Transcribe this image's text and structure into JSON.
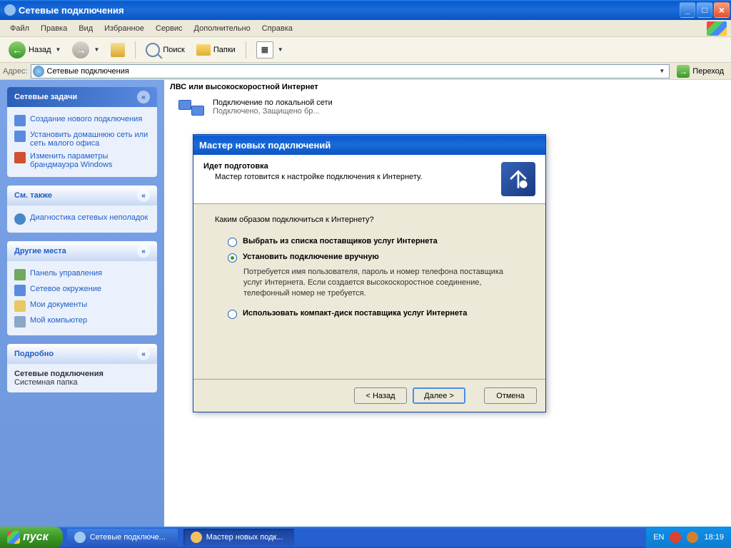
{
  "window": {
    "title": "Сетевые подключения"
  },
  "menu": {
    "file": "Файл",
    "edit": "Правка",
    "view": "Вид",
    "favorites": "Избранное",
    "service": "Сервис",
    "extra": "Дополнительно",
    "help": "Справка"
  },
  "toolbar": {
    "back": "Назад",
    "search": "Поиск",
    "folders": "Папки"
  },
  "address": {
    "label": "Адрес:",
    "value": "Сетевые подключения",
    "go": "Переход"
  },
  "sidebar": {
    "tasks": {
      "title": "Сетевые задачи",
      "items": [
        "Создание нового подключения",
        "Установить домашнюю сеть или сеть малого офиса",
        "Изменить параметры брандмауэра Windows"
      ]
    },
    "see_also": {
      "title": "См. также",
      "item": "Диагностика сетевых неполадок"
    },
    "other": {
      "title": "Другие места",
      "items": [
        "Панель управления",
        "Сетевое окружение",
        "Мои документы",
        "Мой компьютер"
      ]
    },
    "details": {
      "title": "Подробно",
      "name": "Сетевые подключения",
      "type": "Системная папка"
    }
  },
  "content": {
    "category": "ЛВС или высокоскоростной Интернет",
    "conn": {
      "name": "Подключение по локальной сети",
      "status": "Подключено, Защищено бр..."
    }
  },
  "wizard": {
    "title": "Мастер новых подключений",
    "hdr1": "Идет подготовка",
    "hdr2": "Мастер готовится к настройке подключения к Интернету.",
    "question": "Каким образом подключиться к Интернету?",
    "opt1": "Выбрать из списка поставщиков услуг Интернета",
    "opt2": "Установить подключение вручную",
    "opt2_desc": "Потребуется имя пользователя, пароль и  номер телефона поставщика услуг Интернета. Если создается высокоскоростное соединение, телефонный номер не требуется.",
    "opt3": "Использовать компакт-диск поставщика услуг Интернета",
    "back": "< Назад",
    "next": "Далее >",
    "cancel": "Отмена"
  },
  "taskbar": {
    "start": "пуск",
    "task1": "Сетевые подключе...",
    "task2": "Мастер новых подк...",
    "lang": "EN",
    "clock": "18:19"
  }
}
